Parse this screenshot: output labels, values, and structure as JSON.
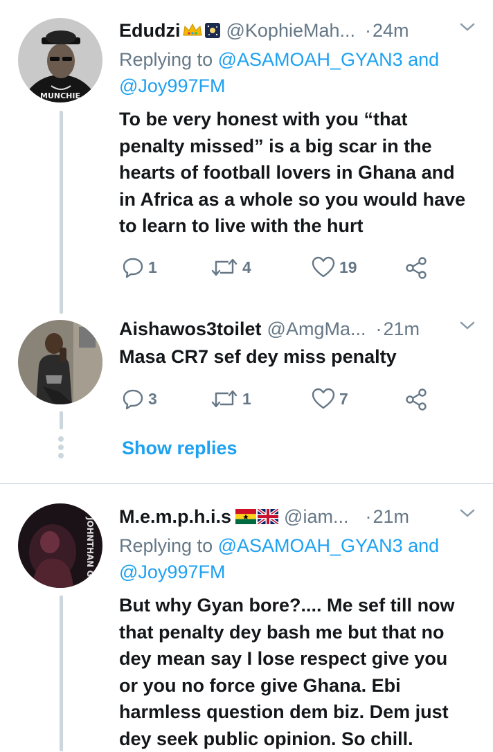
{
  "tweets": [
    {
      "name": "Edudzi",
      "badges": [
        "crown-emoji",
        "sparkle-night-emoji"
      ],
      "handle": "@KophieMah...",
      "separator": "·",
      "time": "24m",
      "reply_prefix": "Replying to",
      "reply_mention_1": "@ASAMOAH_GYAN3",
      "reply_and": "and",
      "reply_mention_2": "@Joy997FM",
      "lines": [
        "To be very honest with you “that",
        "penalty missed” is a big scar in the",
        "hearts of football lovers in Ghana and",
        "in Africa as a whole so you would have",
        "to learn to live with the hurt"
      ],
      "replies": "1",
      "retweets": "4",
      "likes": "19"
    },
    {
      "name": "Aishawos3toilet",
      "handle": "@AmgMa...",
      "separator": "·",
      "time": "21m",
      "lines": [
        "Masa CR7 sef dey miss penalty"
      ],
      "replies": "3",
      "retweets": "1",
      "likes": "7"
    },
    {
      "name": "M.e.m.p.h.i.s",
      "badges": [
        "ghana-flag-emoji",
        "uk-flag-emoji"
      ],
      "handle": "@iam...",
      "separator": "·",
      "time": "21m",
      "reply_prefix": "Replying to",
      "reply_mention_1": "@ASAMOAH_GYAN3",
      "reply_and": "and",
      "reply_mention_2": "@Joy997FM",
      "lines": [
        "But why Gyan bore?.... Me sef till now",
        "that penalty dey bash me but that no",
        "dey mean say I lose respect give you",
        "or you no force give Ghana. Ebi",
        "harmless question dem biz. Dem just",
        "dey seek public opinion. So chill."
      ]
    }
  ],
  "show_replies": "Show replies",
  "colors": {
    "accent": "#1da1f2",
    "muted": "#657786",
    "text": "#14171a",
    "line": "#ccd6dd"
  }
}
